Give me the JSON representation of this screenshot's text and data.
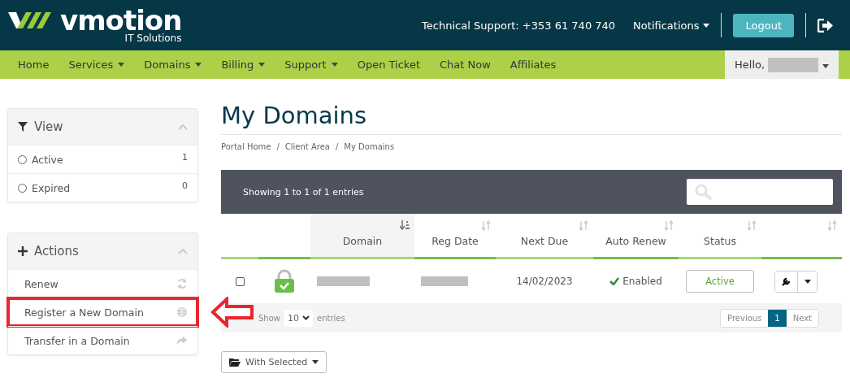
{
  "header": {
    "logo": {
      "name": "vmotion",
      "tagline": "IT Solutions"
    },
    "support": "Technical Support: +353 61 740 740",
    "notifications": "Notifications",
    "logout": "Logout"
  },
  "nav": {
    "items": [
      {
        "label": "Home",
        "has_menu": false
      },
      {
        "label": "Services",
        "has_menu": true
      },
      {
        "label": "Domains",
        "has_menu": true
      },
      {
        "label": "Billing",
        "has_menu": true
      },
      {
        "label": "Support",
        "has_menu": true
      },
      {
        "label": "Open Ticket",
        "has_menu": false
      },
      {
        "label": "Chat Now",
        "has_menu": false
      },
      {
        "label": "Affiliates",
        "has_menu": false
      }
    ],
    "user": "Hello,"
  },
  "sidebar": {
    "view": {
      "title": "View",
      "expanded": true,
      "filters": [
        {
          "label": "Active",
          "count": "1",
          "selected": false
        },
        {
          "label": "Expired",
          "count": "0",
          "selected": false
        }
      ]
    },
    "actions": {
      "title": "Actions",
      "expanded": true,
      "items": [
        {
          "label": "Renew",
          "kind": "refresh",
          "highlighted": false
        },
        {
          "label": "Register a New Domain",
          "kind": "globe",
          "highlighted": true
        },
        {
          "label": "Transfer in a Domain",
          "kind": "share",
          "highlighted": false
        }
      ]
    }
  },
  "page": {
    "title": "My Domains",
    "breadcrumb": [
      "Portal Home",
      "Client Area",
      "My Domains"
    ],
    "separator": "/"
  },
  "table": {
    "info": "Showing 1 to 1 of 1 entries",
    "columns": [
      {
        "label": "Domain",
        "sorted": true
      },
      {
        "label": "Reg Date",
        "sorted": false
      },
      {
        "label": "Next Due",
        "sorted": false
      },
      {
        "label": "Auto Renew",
        "sorted": false
      },
      {
        "label": "Status",
        "sorted": false
      },
      {
        "sorted": false
      }
    ],
    "rows": [
      {
        "checked": false,
        "ssl_active": true,
        "next_due": "14/02/2023",
        "auto_renew": "Enabled",
        "status": "Active"
      }
    ],
    "length": {
      "show": "Show",
      "value": "10",
      "entries": "entries"
    },
    "pagination": {
      "previous": "Previous",
      "pages": [
        {
          "label": "1",
          "selected": true
        }
      ],
      "next": "Next"
    }
  },
  "bulk_button": "With Selected"
}
